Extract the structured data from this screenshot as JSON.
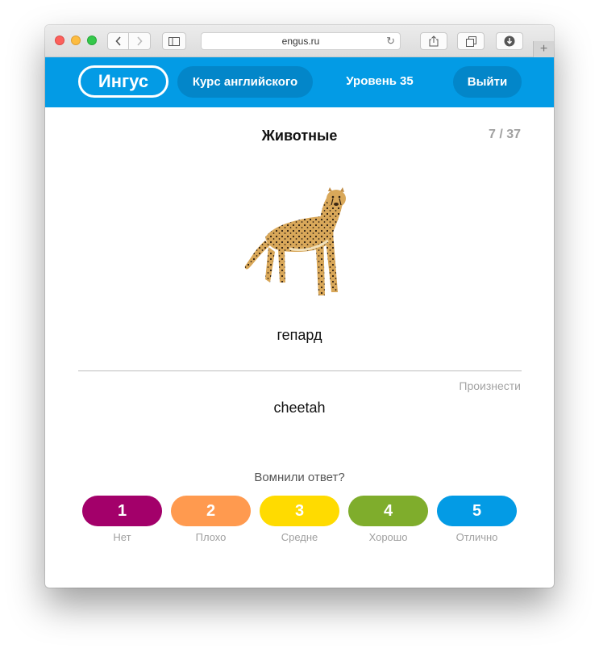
{
  "browser": {
    "url": "engus.ru",
    "plus_tab": "+"
  },
  "header": {
    "logo": "Ингус",
    "course_button": "Курс английского",
    "level_label": "Уровень",
    "level_value": "35",
    "logout_button": "Выйти"
  },
  "card": {
    "topic": "Животные",
    "progress": "7 / 37",
    "image": "cheetah-photo",
    "word_ru": "гепард",
    "pronounce_link": "Произнести",
    "word_en": "cheetah"
  },
  "answer": {
    "question": "Вомнили ответ?",
    "ratings": [
      {
        "value": "1",
        "label": "Нет",
        "color": "#a3006a"
      },
      {
        "value": "2",
        "label": "Плохо",
        "color": "#ff9a4f"
      },
      {
        "value": "3",
        "label": "Средне",
        "color": "#ffdb00"
      },
      {
        "value": "4",
        "label": "Хорошо",
        "color": "#7fad2c"
      },
      {
        "value": "5",
        "label": "Отлично",
        "color": "#039be5"
      }
    ]
  },
  "colors": {
    "header_bg": "#039be5",
    "header_button": "#0386c9"
  }
}
